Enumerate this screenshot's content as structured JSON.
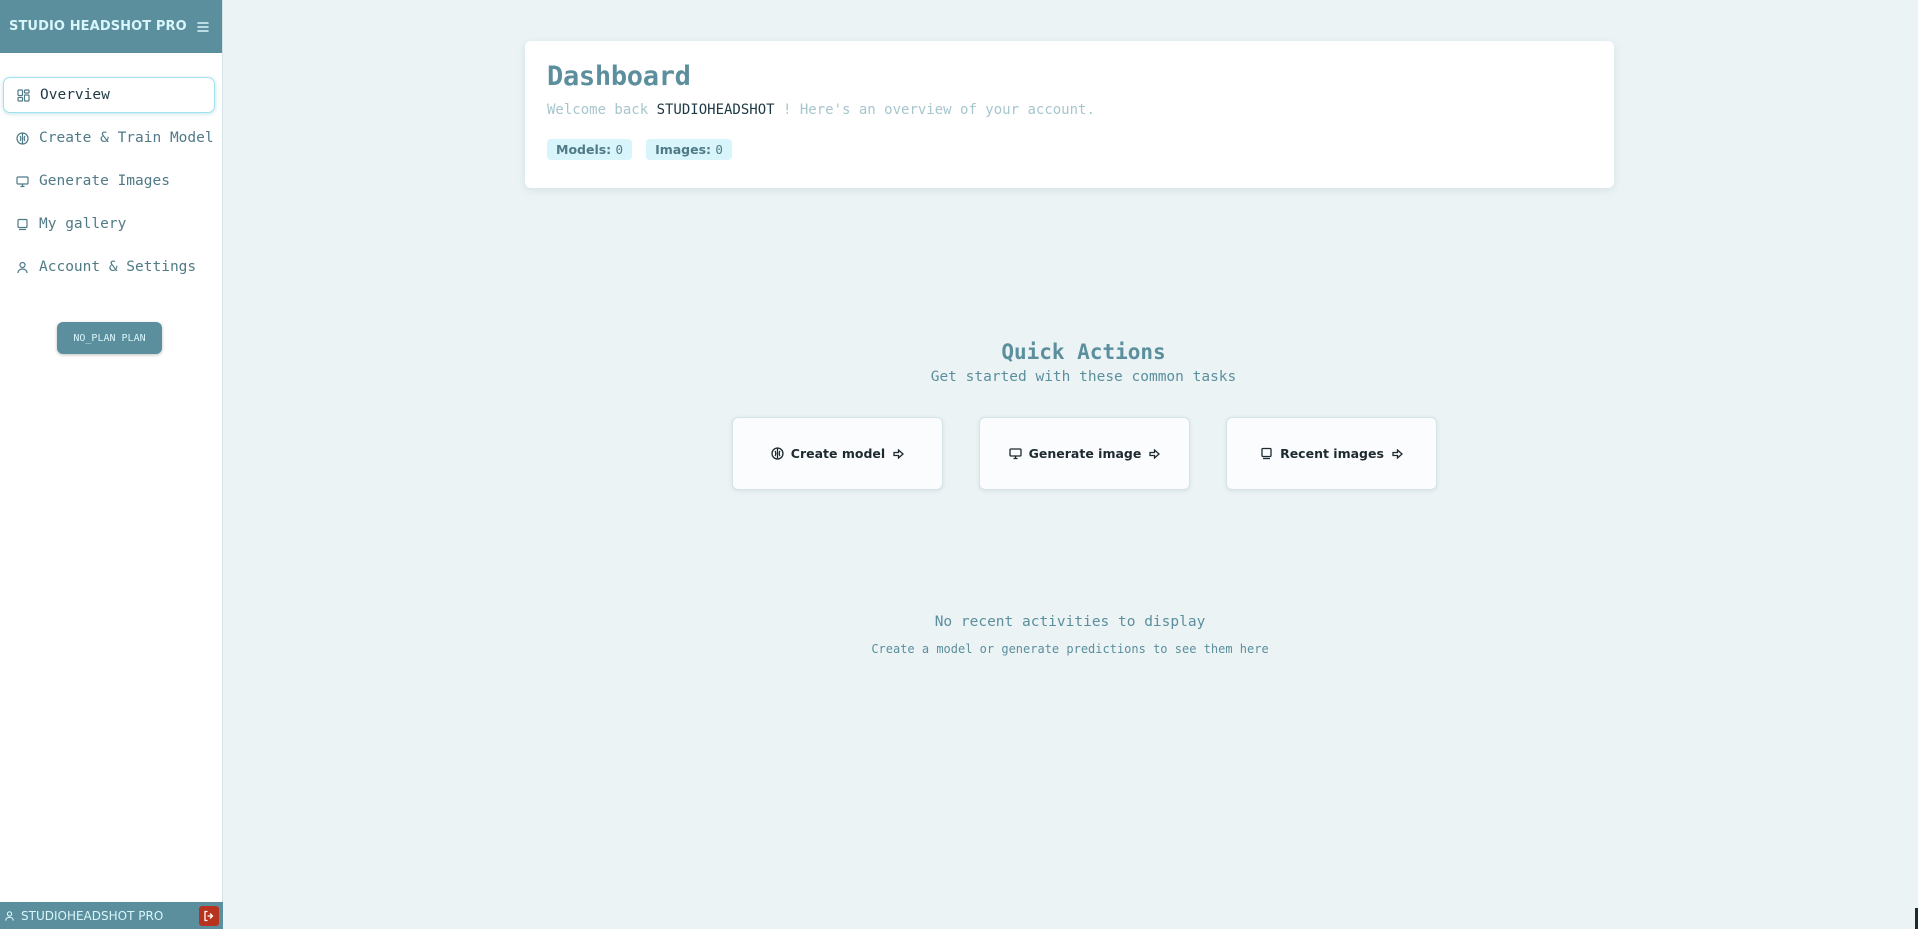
{
  "sidebar": {
    "brand": "STUDIO HEADSHOT PRO",
    "items": [
      {
        "label": "Overview",
        "icon": "grid-icon"
      },
      {
        "label": "Create & Train Model",
        "icon": "brain-icon"
      },
      {
        "label": "Generate Images",
        "icon": "monitor-icon"
      },
      {
        "label": "My gallery",
        "icon": "gallery-icon"
      },
      {
        "label": "Account & Settings",
        "icon": "user-icon"
      }
    ],
    "plan_label": "NO_PLAN PLAN",
    "user_name": "STUDIOHEADSHOT PRO"
  },
  "dashboard": {
    "title": "Dashboard",
    "welcome_prefix": "Welcome back ",
    "username": "STUDIOHEADSHOT",
    "welcome_suffix": " ! Here's an overview of your account.",
    "models_label": "Models: ",
    "models_count": "0",
    "images_label": "Images: ",
    "images_count": "0"
  },
  "quick_actions": {
    "title": "Quick Actions",
    "subtitle": "Get started with these common tasks",
    "cards": [
      {
        "label": "Create model",
        "icon": "brain-icon"
      },
      {
        "label": "Generate image",
        "icon": "monitor-icon"
      },
      {
        "label": "Recent images",
        "icon": "gallery-icon"
      }
    ]
  },
  "activity": {
    "empty_title": "No recent activities to display",
    "empty_subtitle": "Create a model or generate predictions to see them here"
  },
  "colors": {
    "accent": "#5b8f9d",
    "background": "#ebf3f5",
    "badge_bg": "#d7f5fa",
    "logout": "#b8331d"
  }
}
